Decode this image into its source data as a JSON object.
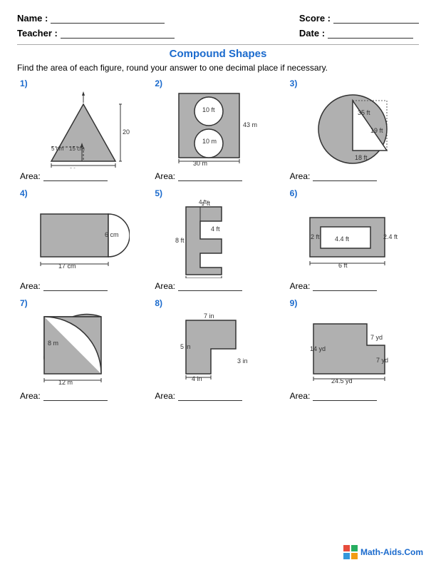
{
  "header": {
    "name_label": "Name :",
    "teacher_label": "Teacher :",
    "score_label": "Score :",
    "date_label": "Date :"
  },
  "title": "Compound Shapes",
  "instructions": "Find the area of each figure, round your answer to one decimal place if necessary.",
  "problems": [
    {
      "num": "1)"
    },
    {
      "num": "2)"
    },
    {
      "num": "3)"
    },
    {
      "num": "4)"
    },
    {
      "num": "5)"
    },
    {
      "num": "6)"
    },
    {
      "num": "7)"
    },
    {
      "num": "8)"
    },
    {
      "num": "9)"
    }
  ],
  "area_label": "Area:",
  "footer": "Math-Aids.Com"
}
